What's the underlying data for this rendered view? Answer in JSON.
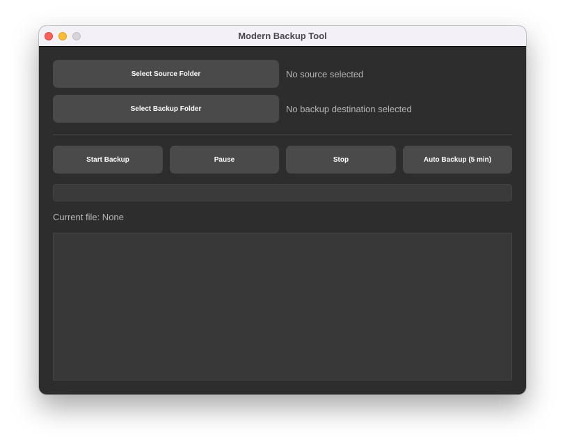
{
  "window": {
    "title": "Modern Backup Tool"
  },
  "source": {
    "button_label": "Select Source Folder",
    "status": "No source selected"
  },
  "destination": {
    "button_label": "Select Backup Folder",
    "status": "No backup destination selected"
  },
  "controls": {
    "start_label": "Start Backup",
    "pause_label": "Pause",
    "stop_label": "Stop",
    "auto_label": "Auto Backup (5 min)"
  },
  "progress": {
    "value_percent": 0
  },
  "current_file": {
    "text": "Current file: None"
  },
  "log": {
    "text": ""
  },
  "icons": {
    "close": "close-icon",
    "minimize": "minimize-icon",
    "maximize": "maximize-icon"
  },
  "colors": {
    "window_bg": "#2d2d2d",
    "button_bg": "#4a4a4a",
    "titlebar_bg": "#f3f0f7",
    "close": "#fe5f57",
    "minimize": "#febc2e",
    "maximize": "#d6d4d9"
  }
}
